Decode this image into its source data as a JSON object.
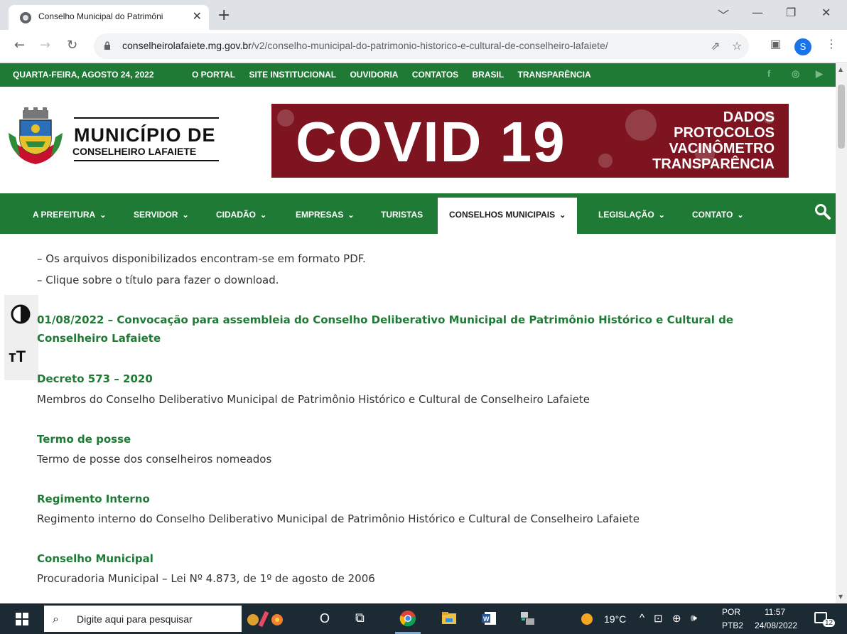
{
  "browser": {
    "tab_title": "Conselho Municipal do Patrimôni",
    "tab_close": "✕",
    "new_tab": "+",
    "window_controls": [
      "﹀",
      "—",
      "❐",
      "✕"
    ],
    "url_domain": "conselheirolafaiete.mg.gov.br",
    "url_path": "/v2/conselho-municipal-do-patrimonio-historico-e-cultural-de-conselheiro-lafaiete/",
    "nav": {
      "back": "←",
      "forward": "→",
      "reload": "↻"
    },
    "toolbar_icons": {
      "share": "⇗",
      "bookmark": "☆",
      "sidepanel": "▣",
      "menu": "⋮"
    },
    "profile_initial": "S"
  },
  "site": {
    "topbar": {
      "date": "QUARTA-FEIRA, AGOSTO 24, 2022",
      "links": [
        "O PORTAL",
        "SITE INSTITUCIONAL",
        "OUVIDORIA",
        "CONTATOS",
        "BRASIL",
        "TRANSPARÊNCIA"
      ],
      "social": [
        "f",
        "◎",
        "▶"
      ]
    },
    "logo": {
      "line1": "MUNICÍPIO DE",
      "line2": "CONSELHEIRO LAFAIETE"
    },
    "banner": {
      "headline": "COVID 19",
      "items": [
        "DADOS",
        "PROTOCOLOS",
        "VACINÔMETRO",
        "TRANSPARÊNCIA"
      ]
    },
    "mainnav": [
      {
        "label": "A PREFEITURA",
        "chevron": "⌄"
      },
      {
        "label": "SERVIDOR",
        "chevron": "⌄"
      },
      {
        "label": "CIDADÃO",
        "chevron": "⌄"
      },
      {
        "label": "EMPRESAS",
        "chevron": "⌄"
      },
      {
        "label": "TURISTAS",
        "chevron": ""
      },
      {
        "label": "CONSELHOS MUNICIPAIS",
        "chevron": "⌄"
      },
      {
        "label": "LEGISLAÇÃO",
        "chevron": "⌄"
      },
      {
        "label": "CONTATO",
        "chevron": "⌄"
      }
    ],
    "active_nav": "CONSELHOS MUNICIPAIS",
    "accessibility": {
      "font_size": "ᴛT"
    },
    "content": {
      "notes": [
        "– Os arquivos disponibilizados encontram-se em formato PDF.",
        "– Clique sobre o título para fazer o download."
      ],
      "featured_link": "01/08/2022 – Convocação para assembleia do Conselho Deliberativo Municipal de Patrimônio Histórico e Cultural de Conselheiro Lafaiete",
      "documents": [
        {
          "title": "Decreto 573 – 2020",
          "description": "Membros do Conselho Deliberativo Municipal de Patrimônio Histórico e Cultural de Conselheiro Lafaiete"
        },
        {
          "title": "Termo de posse",
          "description": "Termo de posse dos conselheiros nomeados"
        },
        {
          "title": "Regimento Interno",
          "description": "Regimento interno do Conselho Deliberativo Municipal de Patrimônio Histórico e Cultural de Conselheiro Lafaiete"
        },
        {
          "title": "Conselho Municipal",
          "description": "Procuradoria Municipal – Lei Nº 4.873, de 1º de agosto de 2006"
        }
      ]
    }
  },
  "taskbar": {
    "search_placeholder": "Digite aqui para pesquisar",
    "search_icon": "⌕",
    "cortana": "O",
    "taskview": "⧉",
    "weather": "19°C",
    "tray_arrow": "^",
    "tray_icons": [
      "⊡",
      "⊕",
      "🕪"
    ],
    "lang_line1": "POR",
    "lang_line2": "PTB2",
    "time": "11:57",
    "date": "24/08/2022",
    "notifications": "12"
  },
  "colors": {
    "site_green": "#1e7a34",
    "banner_red": "#7d1420",
    "taskbar": "#1b2a33"
  }
}
